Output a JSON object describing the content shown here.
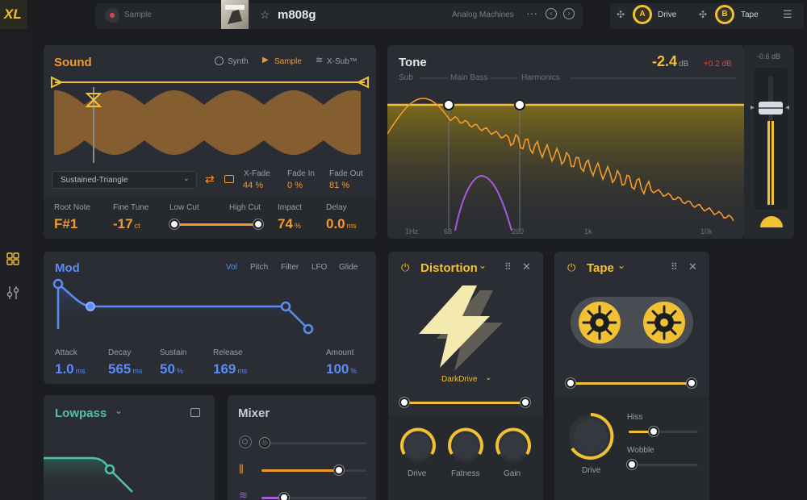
{
  "topbar": {
    "logo": "XL",
    "sample_label": "Sample",
    "preset_name": "m808g",
    "category": "Analog Machines",
    "fx_slots": [
      {
        "letter": "A",
        "name": "Drive"
      },
      {
        "letter": "B",
        "name": "Tape"
      }
    ]
  },
  "sound": {
    "title": "Sound",
    "modes": [
      "Synth",
      "Sample",
      "X-Sub™"
    ],
    "active_mode": "Sample",
    "waveform_select": "Sustained-Triangle",
    "xfade": {
      "label": "X-Fade",
      "value": "44",
      "unit": "%"
    },
    "fadein": {
      "label": "Fade In",
      "value": "0",
      "unit": "%"
    },
    "fadeout": {
      "label": "Fade Out",
      "value": "81",
      "unit": "%"
    },
    "params": {
      "root": {
        "label": "Root Note",
        "value": "F#1"
      },
      "finetune": {
        "label": "Fine Tune",
        "value": "-17",
        "unit": "ct"
      },
      "lowcut": {
        "label": "Low Cut"
      },
      "highcut": {
        "label": "High Cut"
      },
      "impact": {
        "label": "Impact",
        "value": "74",
        "unit": "%"
      },
      "delay": {
        "label": "Delay",
        "value": "0.0",
        "unit": "ms"
      }
    }
  },
  "tone": {
    "title": "Tone",
    "gain": "-2.4",
    "gain_unit": "dB",
    "delta": "+0.2 dB",
    "bands": [
      "Sub",
      "Main Bass",
      "Harmonics"
    ],
    "freq_labels": [
      "1Hz",
      "68",
      "260",
      "1k",
      "10k"
    ],
    "fader_value": "-0.6 dB"
  },
  "mod": {
    "title": "Mod",
    "tabs": [
      "Vol",
      "Pitch",
      "Filter",
      "LFO",
      "Glide"
    ],
    "active_tab": "Vol",
    "params": [
      {
        "label": "Attack",
        "value": "1.0",
        "unit": "ms"
      },
      {
        "label": "Decay",
        "value": "565",
        "unit": "ms"
      },
      {
        "label": "Sustain",
        "value": "50",
        "unit": "%"
      },
      {
        "label": "Release",
        "value": "169",
        "unit": "ms"
      },
      {
        "label": "Amount",
        "value": "100",
        "unit": "%"
      }
    ]
  },
  "distortion": {
    "title": "Distortion",
    "preset": "DarkDrive",
    "knobs": [
      "Drive",
      "Fatness",
      "Gain"
    ]
  },
  "tape": {
    "title": "Tape",
    "knob": "Drive",
    "sliders": [
      "Hiss",
      "Wobble"
    ]
  },
  "filter": {
    "title": "Lowpass"
  },
  "mixer": {
    "title": "Mixer"
  },
  "colors": {
    "accent": "#f2c133",
    "orange": "#f29a2e",
    "blue": "#5b8cf5",
    "teal": "#4ec3a7"
  }
}
